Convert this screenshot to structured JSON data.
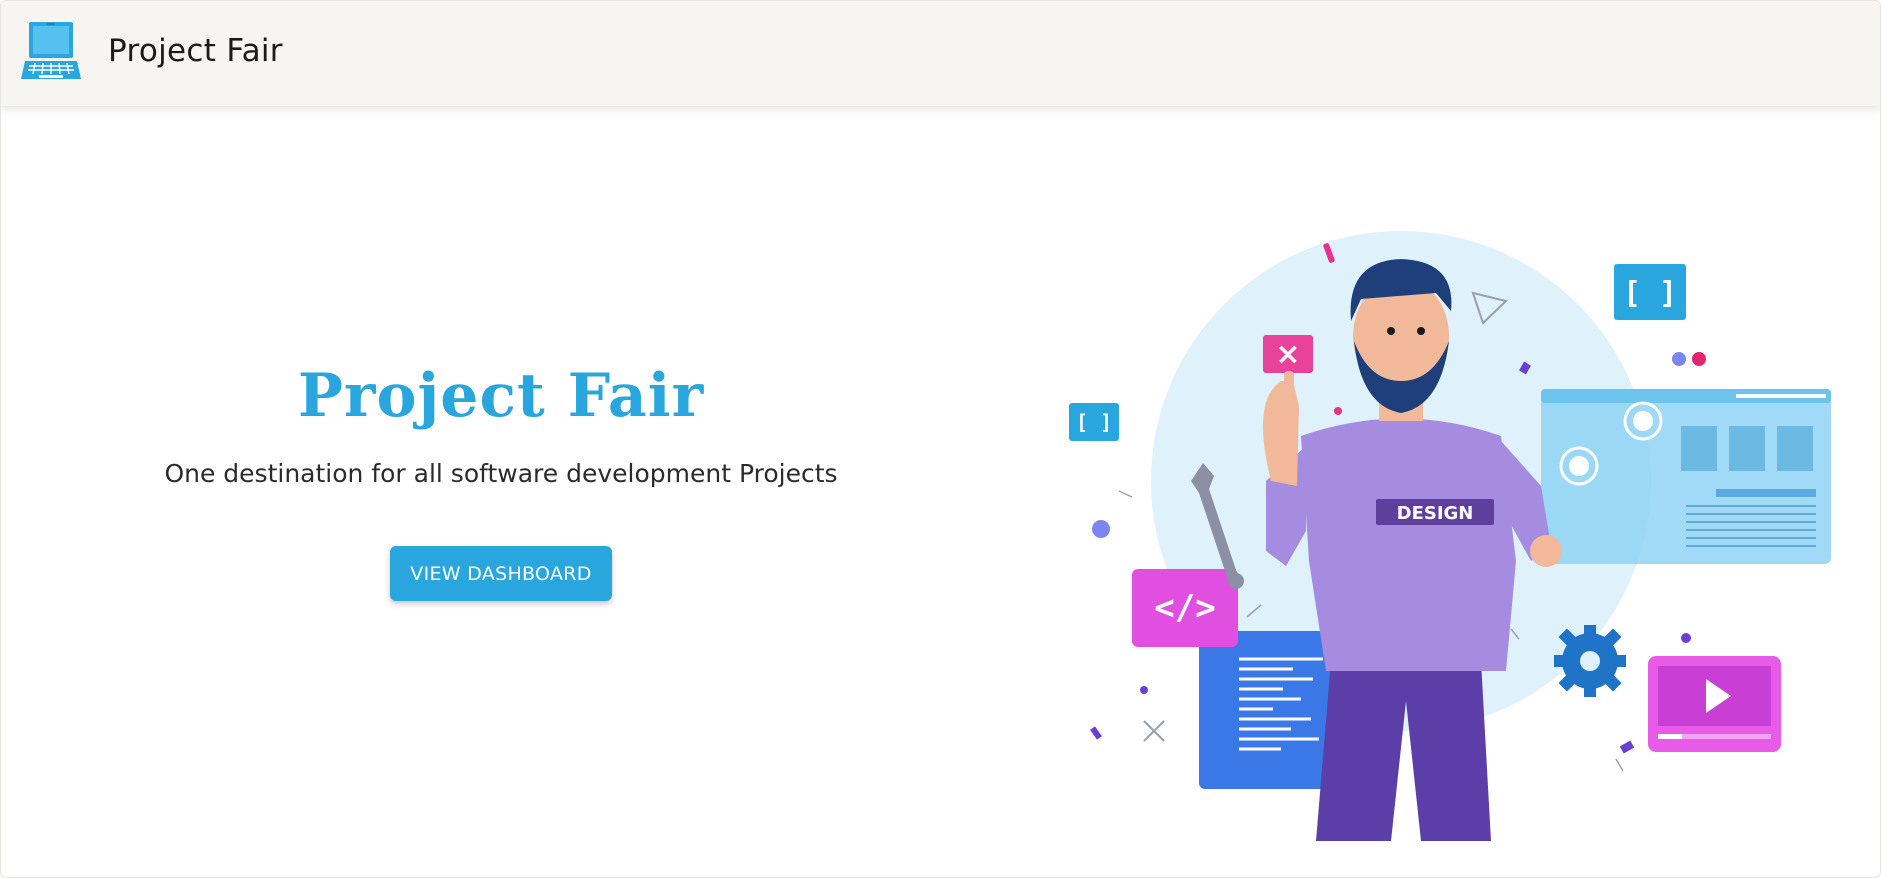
{
  "navbar": {
    "brand_text": "Project Fair",
    "logo_icon": "laptop-icon"
  },
  "hero": {
    "title": "Project Fair",
    "subtitle": "One destination for all software development Projects",
    "cta_label": "VIEW DASHBOARD"
  },
  "illustration": {
    "shirt_text": "DESIGN",
    "bracket_text": "[ ]",
    "code_text": "</>",
    "close_text": "×"
  },
  "colors": {
    "accent": "#2aa6de",
    "navbar_bg": "#f7f5f1",
    "text_dark": "#1a1a1a"
  }
}
